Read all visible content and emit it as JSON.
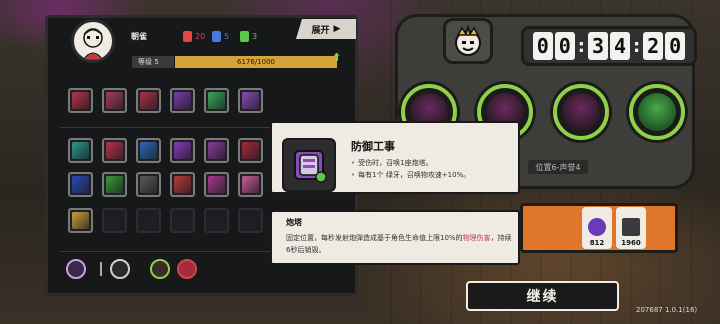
{
  "player": {
    "name": "朝雀",
    "stats": [
      {
        "icon": "red-figure-icon",
        "value": "20",
        "color": "#e04848"
      },
      {
        "icon": "blue-figure-icon",
        "value": "5",
        "color": "#4a78e0"
      },
      {
        "icon": "green-figure-icon",
        "value": "3",
        "color": "#5ac84a"
      }
    ],
    "level_label": "等级 5",
    "xp_text": "6176/1000",
    "xp_fraction": 1.0,
    "expand_label": "展开"
  },
  "colors": {
    "xp": "#d4a43a",
    "accent_green": "#8fd14a",
    "orange": "#e0762a",
    "highlight_red": "#c2415a"
  },
  "inventory": {
    "row1": [
      {
        "name": "red-claw-item",
        "color": "#b8324a"
      },
      {
        "name": "red-beast-item",
        "color": "#a83a5a"
      },
      {
        "name": "red-flame-item",
        "color": "#a8324a"
      },
      {
        "name": "purple-turret-item",
        "color": "#7a3aa8"
      },
      {
        "name": "green-tree-item",
        "color": "#3aa85a"
      },
      {
        "name": "purple-armor-item",
        "color": "#8a4ab8"
      }
    ],
    "row2": [
      {
        "name": "teal-slash-item",
        "color": "#2a9a8a"
      },
      {
        "name": "red-blade-item",
        "color": "#b8324a"
      },
      {
        "name": "blue-star-item",
        "color": "#2a6ab8"
      },
      {
        "name": "purple-chevron-item",
        "color": "#8a3ab8"
      },
      {
        "name": "purple-swirl-item",
        "color": "#8a3a9a"
      },
      {
        "name": "red-hook-item",
        "color": "#a82a3a"
      }
    ],
    "row3": [
      {
        "name": "blue-pillar-item",
        "color": "#2a4ab8"
      },
      {
        "name": "green-arrow-item",
        "color": "#3a9a3a"
      },
      {
        "name": "grey-badge-item",
        "color": "#5a5a5a"
      },
      {
        "name": "red-leaf-item",
        "color": "#b83a3a"
      },
      {
        "name": "purple-fang-item",
        "color": "#a83a8a"
      },
      {
        "name": "pink-feather-item",
        "color": "#c85a9a"
      }
    ],
    "row4": [
      {
        "name": "gold-crest-item",
        "color": "#c8a03a"
      }
    ]
  },
  "tooltip": {
    "title": "防御工事",
    "lines": [
      "受伤时，召唤1座炮塔。",
      "每有1个  绿牙，召唤物攻速+10%。"
    ],
    "sub_title": "炮塔",
    "sub_desc_prefix": "固定位置，每秒发射炮弹造成基于角色生命值上限10%的",
    "sub_desc_highlight": "物理伤害",
    "sub_desc_suffix": "，持续6秒后销毁。"
  },
  "hud": {
    "timer": [
      "0",
      "0",
      "3",
      "4",
      "2",
      "0"
    ],
    "level_tag": "位置6-声誉4",
    "resources": [
      {
        "name": "purple-orb-resource",
        "value": "812"
      },
      {
        "name": "card-resource",
        "value": "1960"
      }
    ],
    "continue_label": "继续",
    "build": "207687 1.0.1(16)"
  }
}
